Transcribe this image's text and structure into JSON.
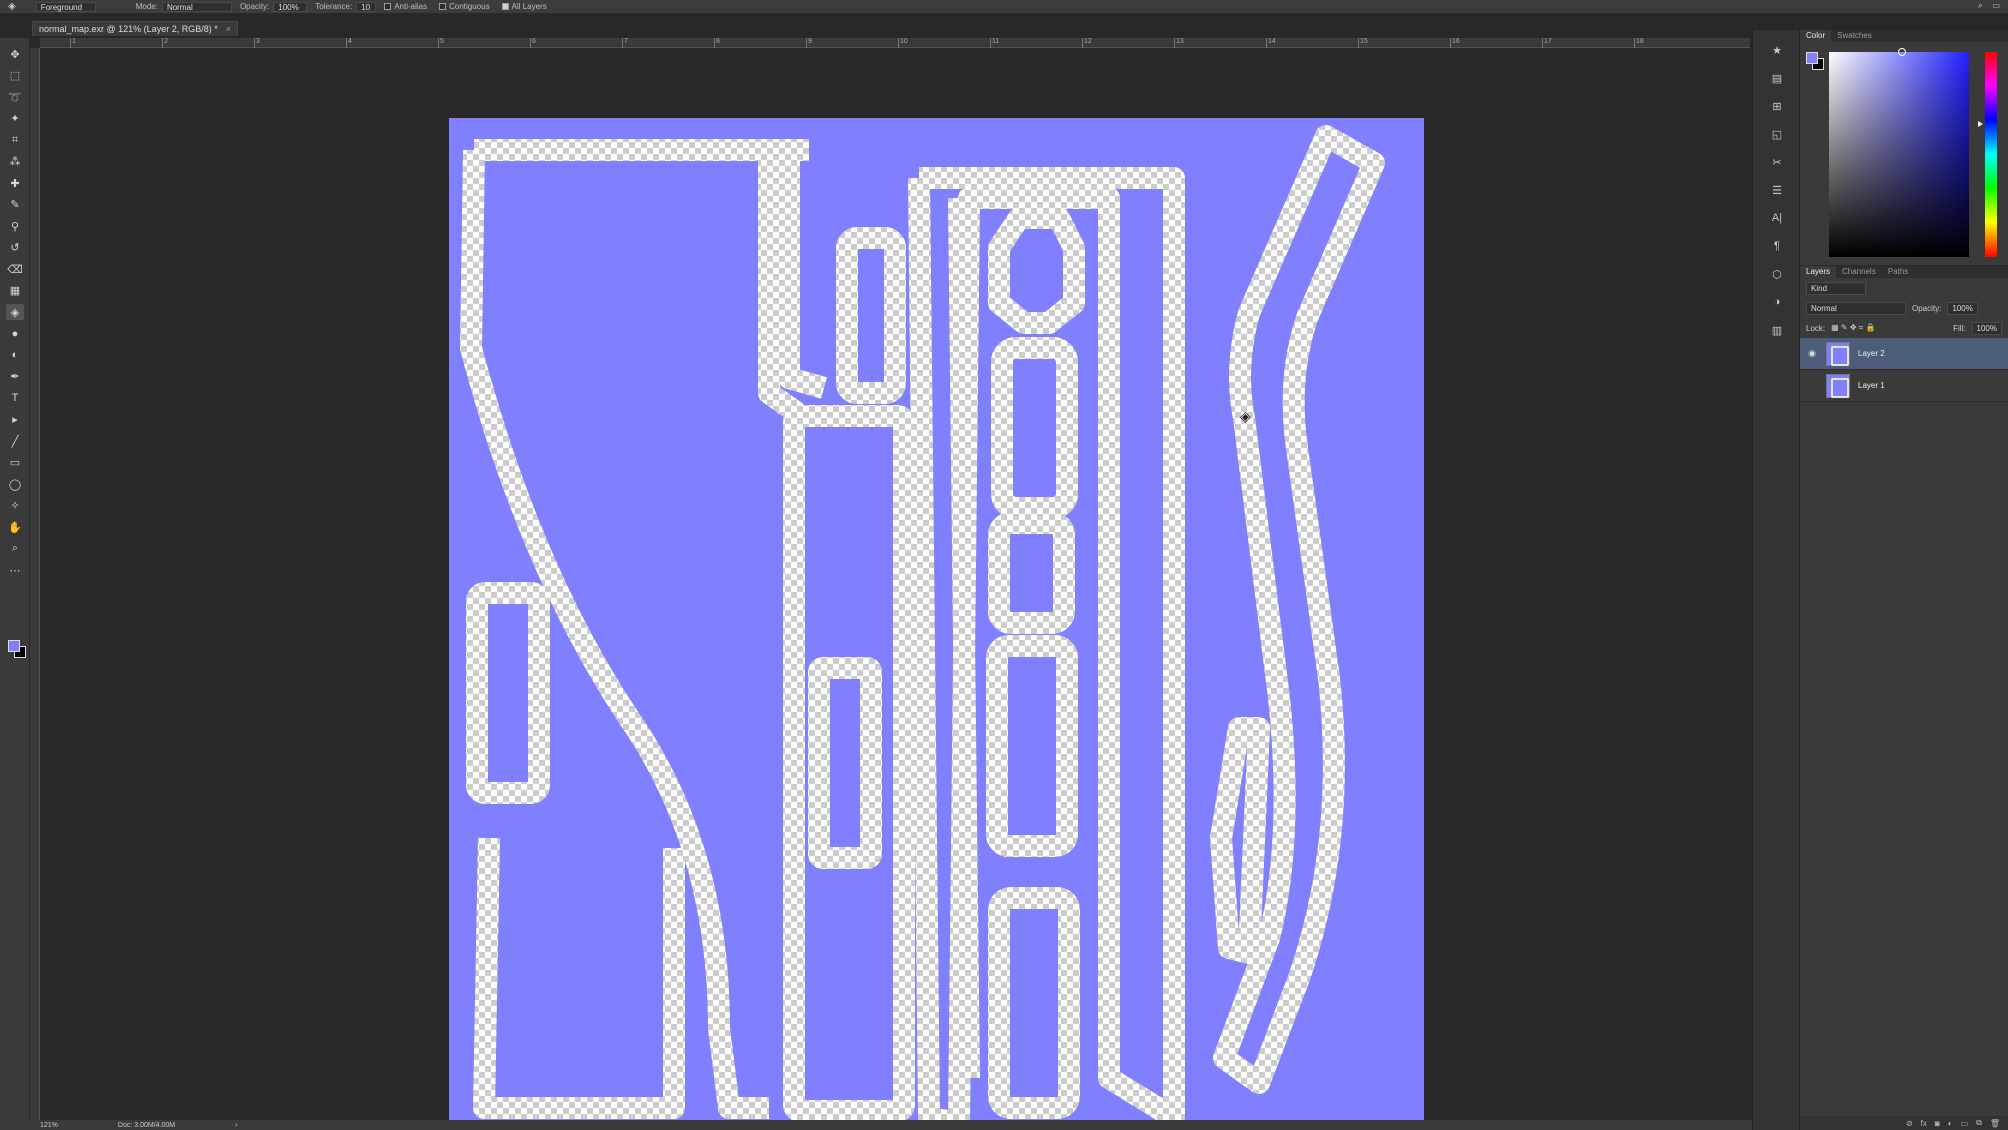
{
  "options_bar": {
    "fill_label": "Foreground",
    "mode_label": "Mode:",
    "mode_value": "Normal",
    "opacity_label": "Opacity:",
    "opacity_value": "100%",
    "tolerance_label": "Tolerance:",
    "tolerance_value": "10",
    "anti_alias_label": "Anti-alias",
    "anti_alias_checked": false,
    "contiguous_label": "Contiguous",
    "contiguous_checked": false,
    "all_layers_label": "All Layers",
    "all_layers_checked": true
  },
  "document_tab": {
    "title": "normal_map.exr @ 121% (Layer 2, RGB/8) *",
    "close": "×"
  },
  "ruler": {
    "labels": [
      "1",
      "2",
      "3",
      "4",
      "5",
      "6",
      "7",
      "8",
      "9",
      "10",
      "11",
      "12",
      "13",
      "14",
      "15",
      "16",
      "17",
      "18"
    ]
  },
  "toolbox": {
    "tools": [
      "move-tool",
      "marquee-tool",
      "lasso-tool",
      "magic-wand-tool",
      "crop-tool",
      "eyedropper-tool",
      "healing-tool",
      "brush-tool",
      "stamp-tool",
      "history-brush-tool",
      "eraser-tool",
      "gradient-tool",
      "paint-bucket-tool",
      "blur-tool",
      "dodge-tool",
      "pen-tool",
      "type-tool",
      "path-selection-tool",
      "line-tool",
      "rectangle-tool",
      "ellipse-tool",
      "custom-shape-tool",
      "hand-tool",
      "zoom-tool",
      "more-tools"
    ],
    "glyphs": [
      "✥",
      "⬚",
      "➰",
      "✦",
      "⌗",
      "⁂",
      "✚",
      "✎",
      "⚲",
      "↺",
      "⌫",
      "▦",
      "◈",
      "●",
      "◐",
      "✒",
      "T",
      "▸",
      "╱",
      "▭",
      "◯",
      "✧",
      "✋",
      "⌕",
      "⋯"
    ],
    "active_tool": "paint-bucket-tool",
    "foreground_color": "#8080ff",
    "background_color": "#000000"
  },
  "canvas": {
    "background_color": "#8080ff"
  },
  "status_bar": {
    "zoom": "121%",
    "doc_info": "Doc: 3.00M/4.00M",
    "arrow": "›"
  },
  "dock_icons": [
    "★",
    "▤",
    "⊞",
    "◱",
    "✂",
    "☰",
    "A|",
    "¶",
    "⬡",
    "◑",
    "▥"
  ],
  "color_panel": {
    "tabs": [
      "Color",
      "Swatches"
    ],
    "active_tab": "Color",
    "foreground": "#8080ff",
    "background": "#000000"
  },
  "layers_panel": {
    "tabs": [
      "Layers",
      "Channels",
      "Paths"
    ],
    "active_tab": "Layers",
    "filter_value": "Kind",
    "blend_mode": "Normal",
    "opacity_label": "Opacity:",
    "opacity_value": "100%",
    "lock_label": "Lock:",
    "fill_label": "Fill:",
    "fill_value": "100%",
    "layers": [
      {
        "name": "Layer 2",
        "visible": true,
        "selected": true
      },
      {
        "name": "Layer 1",
        "visible": false,
        "selected": false
      }
    ],
    "footer_icons": [
      "⊘",
      "fx",
      "◙",
      "◐",
      "▭",
      "⧉",
      "🗑"
    ]
  }
}
